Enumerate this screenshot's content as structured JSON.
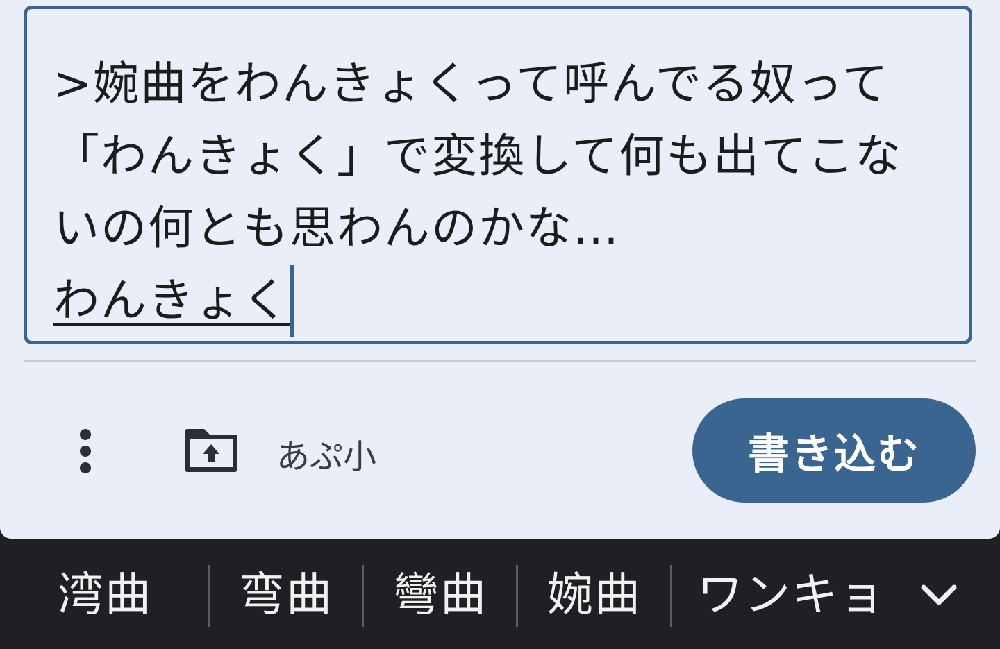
{
  "compose": {
    "text_lines": [
      ">婉曲をわんきょくって呼んでる奴って",
      "「わんきょく」で変換して何も出てこな",
      "いの何とも思わんのかな…"
    ],
    "composing_text": "わんきょく",
    "name_field_value": "あぷ小",
    "submit_label": "書き込む",
    "more_icon": "more-vertical-icon",
    "upload_icon": "folder-upload-icon"
  },
  "ime": {
    "candidates": [
      "湾曲",
      "弯曲",
      "彎曲",
      "婉曲",
      "ワンキョ"
    ],
    "expand_icon": "chevron-down-icon"
  },
  "colors": {
    "accent": "#3a6590",
    "panel_bg": "#e9eef8",
    "ime_bg": "#1f2024"
  }
}
